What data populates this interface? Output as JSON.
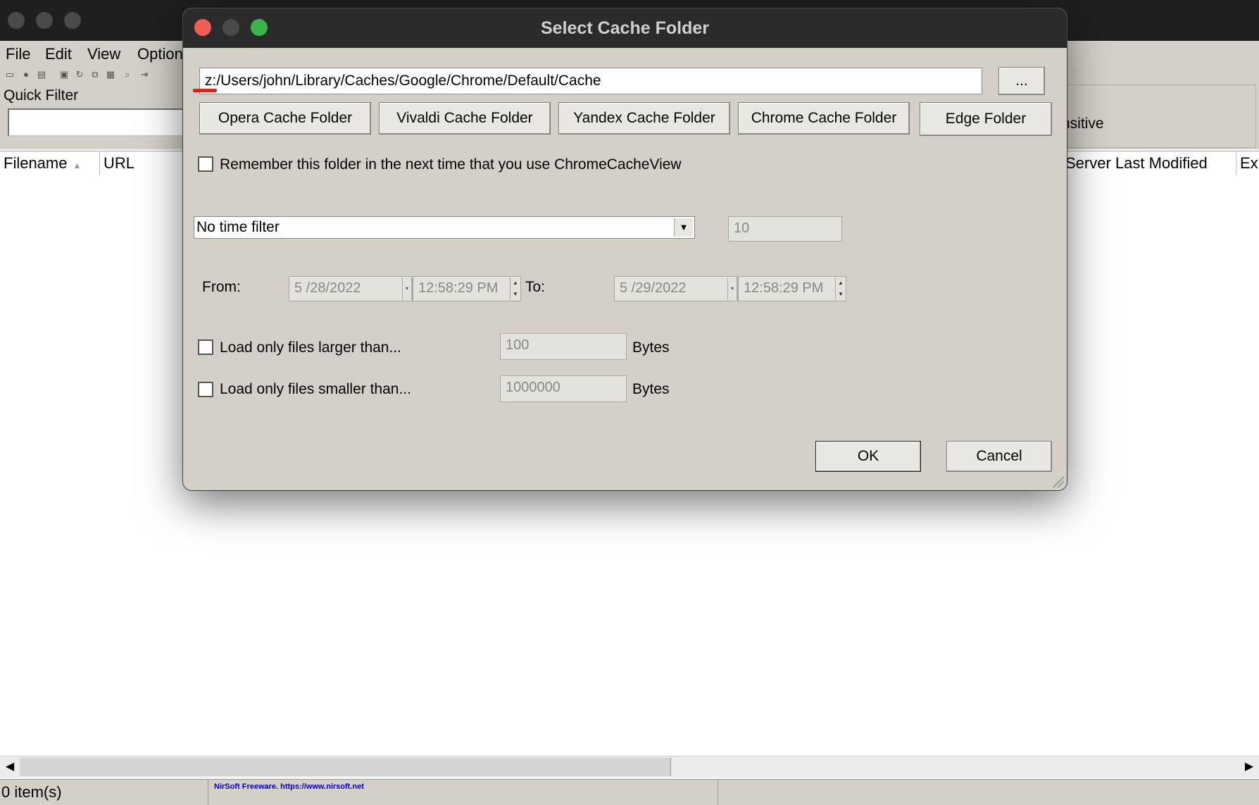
{
  "window": {
    "menu": [
      "File",
      "Edit",
      "View",
      "Option"
    ],
    "quick_filter_label": "Quick Filter",
    "quick_filter_value": "",
    "filter_right_text": "nsitive",
    "columns": [
      "Filename",
      "URL",
      "Server Last Modified",
      "Ex"
    ],
    "status_count": "0 item(s)",
    "status_link": "NirSoft Freeware. https://www.nirsoft.net"
  },
  "dialog": {
    "title": "Select Cache Folder",
    "path_value": "z:/Users/john/Library/Caches/Google/Chrome/Default/Cache",
    "browse_label": "...",
    "folder_buttons": [
      "Opera Cache Folder",
      "Vivaldi Cache Folder",
      "Yandex Cache Folder",
      "Chrome Cache Folder",
      "Edge Folder"
    ],
    "remember_label": "Remember this folder in the next time that you use ChromeCacheView",
    "remember_checked": false,
    "time_filter": {
      "selected": "No time filter",
      "value": "10"
    },
    "from_label": "From:",
    "from_date": "5 /28/2022",
    "from_time": "12:58:29 PM",
    "to_label": "To:",
    "to_date": "5 /29/2022",
    "to_time": "12:58:29 PM",
    "larger": {
      "label": "Load only files larger than...",
      "value": "100",
      "unit": "Bytes",
      "checked": false
    },
    "smaller": {
      "label": "Load only files smaller than...",
      "value": "1000000",
      "unit": "Bytes",
      "checked": false
    },
    "ok_label": "OK",
    "cancel_label": "Cancel"
  },
  "colors": {
    "dialog_bg": "#d4d0c8",
    "close": "#ee5e55",
    "minimize": "#4a4a4a",
    "zoom": "#3ab54a",
    "annotation_red": "#cc2a1e",
    "link": "#0000cc"
  }
}
